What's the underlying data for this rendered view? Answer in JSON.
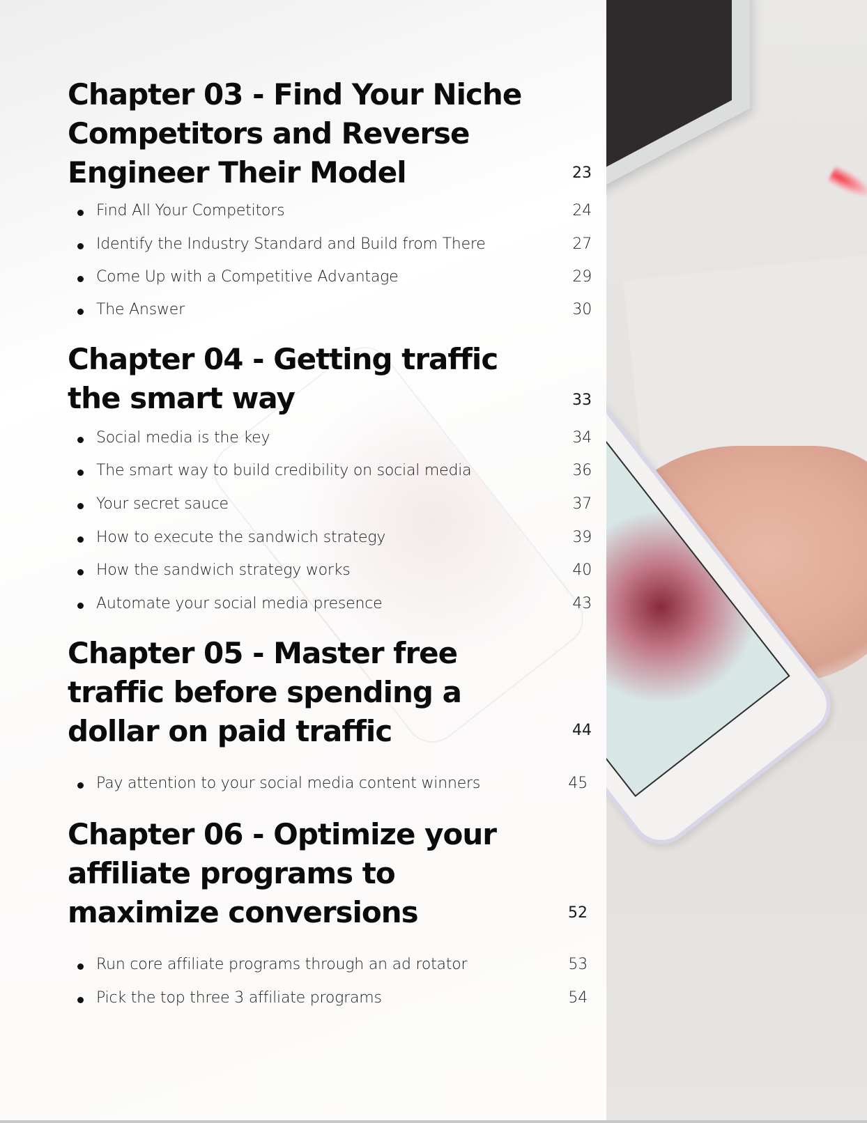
{
  "toc": {
    "chapters": [
      {
        "title": "Chapter 03 - Find Your Niche Competitors and Reverse Engineer Their Model",
        "page": "23",
        "items": [
          {
            "label": "Find All Your Competitors",
            "page": "24"
          },
          {
            "label": "Identify the Industry Standard and Build from There",
            "page": "27"
          },
          {
            "label": "Come Up with a Competitive Advantage",
            "page": "29"
          },
          {
            "label": "The Answer",
            "page": "30"
          }
        ]
      },
      {
        "title": "Chapter 04 - Getting traffic the smart way",
        "page": "33",
        "items": [
          {
            "label": "Social media is the key",
            "page": "34"
          },
          {
            "label": "The smart way to build credibility on social media",
            "page": "36"
          },
          {
            "label": "Your secret sauce",
            "page": "37"
          },
          {
            "label": "How to execute the sandwich strategy",
            "page": "39"
          },
          {
            "label": "How the sandwich strategy works",
            "page": "40"
          },
          {
            "label": "Automate your social media presence",
            "page": "43"
          }
        ]
      },
      {
        "title": "Chapter 05 - Master free traffic before spending a dollar on paid traffic",
        "page": "44",
        "items": [
          {
            "label": "Pay attention to your social media content winners",
            "page": "45"
          }
        ]
      },
      {
        "title": "Chapter 06 - Optimize your affiliate programs to maximize conversions",
        "page": "52",
        "items": [
          {
            "label": "Run core affiliate programs through an ad rotator",
            "page": "53"
          },
          {
            "label": "Pick the top three 3 affiliate programs",
            "page": "54"
          }
        ]
      }
    ]
  },
  "colors": {
    "text": "#0b0b0b",
    "page_background": "#ffffff",
    "accent_pen": "#f03a46"
  }
}
